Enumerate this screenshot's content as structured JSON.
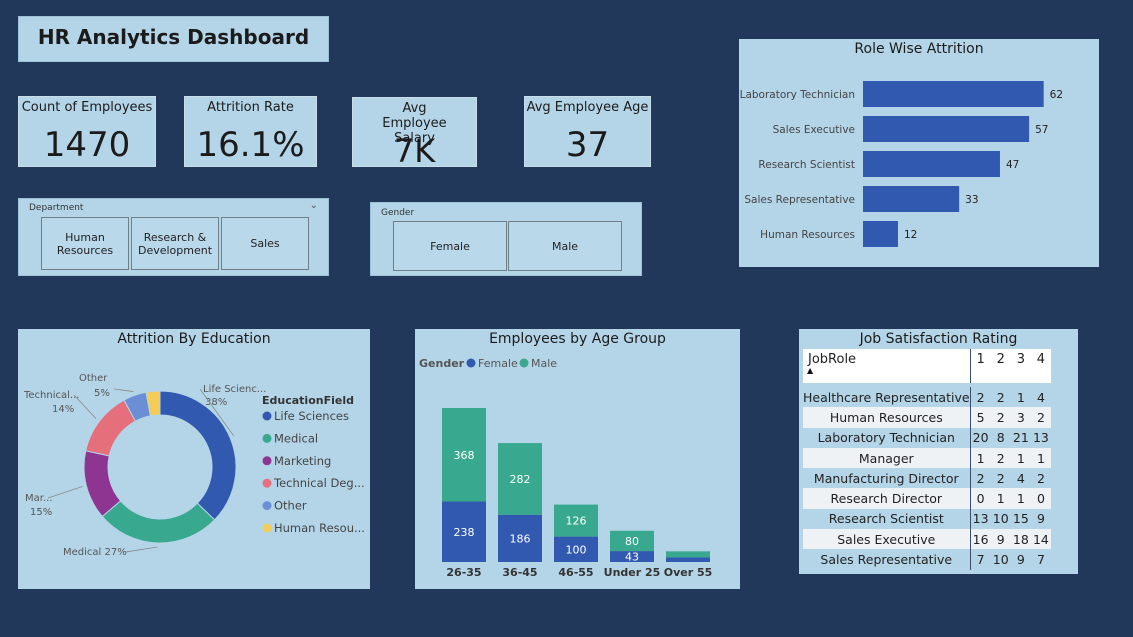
{
  "dashboard": {
    "title": "HR Analytics Dashboard"
  },
  "kpis": [
    {
      "label": "Count of Employees",
      "value": "1470"
    },
    {
      "label": "Attrition Rate",
      "value": "16.1%"
    },
    {
      "label": "Avg Employee Salary",
      "value": "7K"
    },
    {
      "label": "Avg Employee Age",
      "value": "37"
    }
  ],
  "department_slicer": {
    "title": "Department",
    "options": [
      "Human Resources",
      "Research & Development",
      "Sales"
    ]
  },
  "gender_slicer": {
    "title": "Gender",
    "options": [
      "Female",
      "Male"
    ]
  },
  "colors": {
    "blue": "#3159b0",
    "teal": "#38a88e",
    "purple": "#8e3591",
    "pink": "#e5707c",
    "lightblue": "#6a8fd4",
    "yellow": "#f5cc55",
    "background": "#22385a",
    "panel": "#b4d5e8"
  },
  "chart_data": [
    {
      "type": "bar",
      "title": "Role Wise Attrition",
      "orientation": "horizontal",
      "categories": [
        "Laboratory Technician",
        "Sales Executive",
        "Research Scientist",
        "Sales Representative",
        "Human Resources"
      ],
      "values": [
        62,
        57,
        47,
        33,
        12
      ]
    },
    {
      "type": "pie",
      "title": "Attrition By Education",
      "legend_title": "EducationField",
      "legend_labels": [
        "Life Sciences",
        "Medical",
        "Marketing",
        "Technical Deg...",
        "Other",
        "Human Resou..."
      ],
      "slice_labels": [
        "Life Scienc...",
        "Medical 27%",
        "Mar...",
        "Technical...",
        "Other",
        "Human Resou..."
      ],
      "slice_pct_labels": [
        "38%",
        "",
        "15%",
        "14%",
        "5%",
        ""
      ],
      "values": [
        38,
        27,
        15,
        14,
        5,
        3
      ]
    },
    {
      "type": "bar",
      "stacked": true,
      "title": "Employees by Age Group",
      "legend_title": "Gender",
      "categories": [
        "26-35",
        "36-45",
        "46-55",
        "Under 25",
        "Over 55"
      ],
      "series": [
        {
          "name": "Female",
          "values": [
            238,
            186,
            100,
            43,
            18
          ]
        },
        {
          "name": "Male",
          "values": [
            368,
            282,
            126,
            80,
            24
          ]
        }
      ],
      "data_labels": [
        [
          "238",
          "186",
          "100",
          "43",
          ""
        ],
        [
          "368",
          "282",
          "126",
          "80",
          ""
        ]
      ]
    },
    {
      "type": "table",
      "title": "Job Satisfaction Rating",
      "columns": [
        "JobRole",
        "1",
        "2",
        "3",
        "4"
      ],
      "rows": [
        [
          "Healthcare Representative",
          "2",
          "2",
          "1",
          "4"
        ],
        [
          "Human Resources",
          "5",
          "2",
          "3",
          "2"
        ],
        [
          "Laboratory Technician",
          "20",
          "8",
          "21",
          "13"
        ],
        [
          "Manager",
          "1",
          "2",
          "1",
          "1"
        ],
        [
          "Manufacturing Director",
          "2",
          "2",
          "4",
          "2"
        ],
        [
          "Research Director",
          "0",
          "1",
          "1",
          "0"
        ],
        [
          "Research Scientist",
          "13",
          "10",
          "15",
          "9"
        ],
        [
          "Sales Executive",
          "16",
          "9",
          "18",
          "14"
        ],
        [
          "Sales Representative",
          "7",
          "10",
          "9",
          "7"
        ]
      ]
    }
  ]
}
